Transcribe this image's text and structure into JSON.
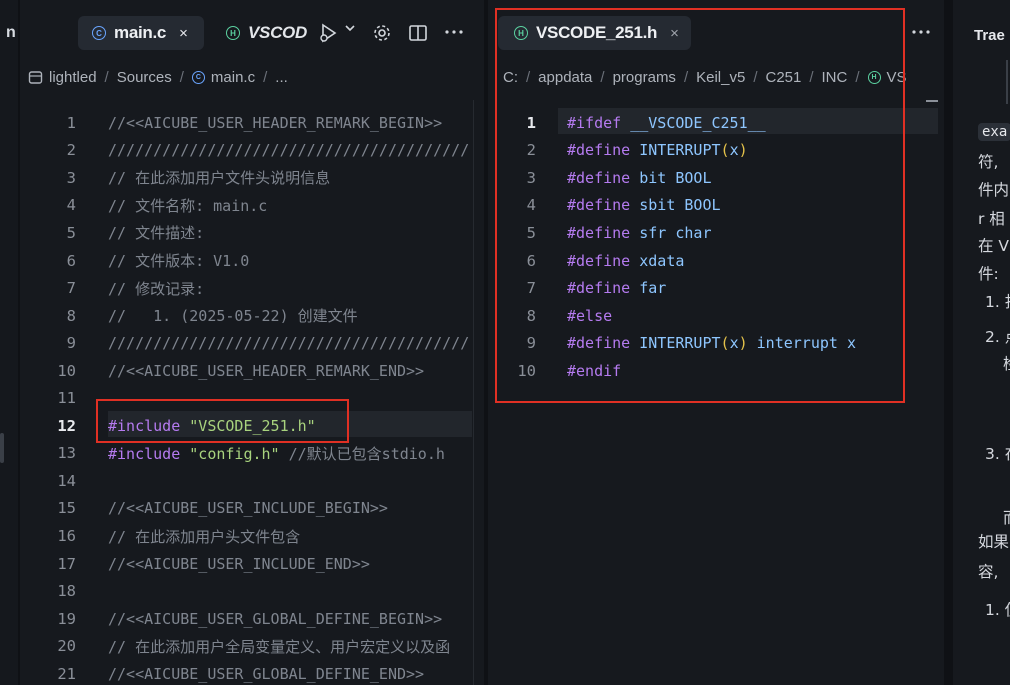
{
  "left_pane": {
    "label": "n"
  },
  "main_editor": {
    "tabs": [
      {
        "label": "main.c",
        "icon": "c-file-icon",
        "close": "×"
      },
      {
        "label": "VSCOD",
        "icon": "h-file-icon"
      }
    ],
    "breadcrumb": [
      "lightled",
      "Sources",
      "main.c",
      "..."
    ],
    "lines": [
      {
        "n": "1",
        "text": "//<<AICUBE_USER_HEADER_REMARK_BEGIN>>"
      },
      {
        "n": "2",
        "text": "////////////////////////////////////////"
      },
      {
        "n": "3",
        "text": "// 在此添加用户文件头说明信息"
      },
      {
        "n": "4",
        "text": "// 文件名称: main.c"
      },
      {
        "n": "5",
        "text": "// 文件描述:"
      },
      {
        "n": "6",
        "text": "// 文件版本: V1.0"
      },
      {
        "n": "7",
        "text": "// 修改记录:"
      },
      {
        "n": "8",
        "text": "//   1. (2025-05-22) 创建文件"
      },
      {
        "n": "9",
        "text": "////////////////////////////////////////"
      },
      {
        "n": "10",
        "text": "//<<AICUBE_USER_HEADER_REMARK_END>>"
      },
      {
        "n": "11",
        "text": ""
      },
      {
        "n": "12",
        "kw": "#include",
        "str": "\"VSCODE_251.h\""
      },
      {
        "n": "13",
        "kw": "#include",
        "str": "\"config.h\"",
        "cmt": " //默认已包含stdio.h"
      },
      {
        "n": "14",
        "text": ""
      },
      {
        "n": "15",
        "text": "//<<AICUBE_USER_INCLUDE_BEGIN>>"
      },
      {
        "n": "16",
        "text": "// 在此添加用户头文件包含"
      },
      {
        "n": "17",
        "text": "//<<AICUBE_USER_INCLUDE_END>>"
      },
      {
        "n": "18",
        "text": ""
      },
      {
        "n": "19",
        "text": "//<<AICUBE_USER_GLOBAL_DEFINE_BEGIN>>"
      },
      {
        "n": "20",
        "text": "// 在此添加用户全局变量定义、用户宏定义以及函"
      },
      {
        "n": "21",
        "text": "//<<AICUBE_USER_GLOBAL_DEFINE_END>>"
      }
    ]
  },
  "header_editor": {
    "tab": {
      "label": "VSCODE_251.h",
      "close": "×"
    },
    "breadcrumb": [
      "C:",
      "appdata",
      "programs",
      "Keil_v5",
      "C251",
      "INC",
      "VS"
    ],
    "lines": [
      {
        "n": "1",
        "kw": "#ifdef",
        "id": "__VSCODE_C251__"
      },
      {
        "n": "2",
        "kw": "#define",
        "id": "INTERRUPT",
        "po": "(",
        "arg": "x",
        "pc": ")"
      },
      {
        "n": "3",
        "kw": "#define",
        "id": "bit BOOL"
      },
      {
        "n": "4",
        "kw": "#define",
        "id": "sbit BOOL"
      },
      {
        "n": "5",
        "kw": "#define",
        "id": "sfr char"
      },
      {
        "n": "6",
        "kw": "#define",
        "id": "xdata"
      },
      {
        "n": "7",
        "kw": "#define",
        "id": "far"
      },
      {
        "n": "8",
        "kw": "#else"
      },
      {
        "n": "9",
        "kw": "#define",
        "id": "INTERRUPT",
        "po": "(",
        "arg": "x",
        "pc": ")",
        "tail": " interrupt x"
      },
      {
        "n": "10",
        "kw": "#endif"
      }
    ]
  },
  "chat_panel": {
    "title": "Trae",
    "fragments": [
      "exa",
      "符,",
      "件内",
      "r 相",
      "在 V",
      "件:",
      "1. 打",
      "2. 点",
      "检",
      "3. 在",
      "而",
      "如果",
      "容,",
      "1. 使"
    ]
  }
}
